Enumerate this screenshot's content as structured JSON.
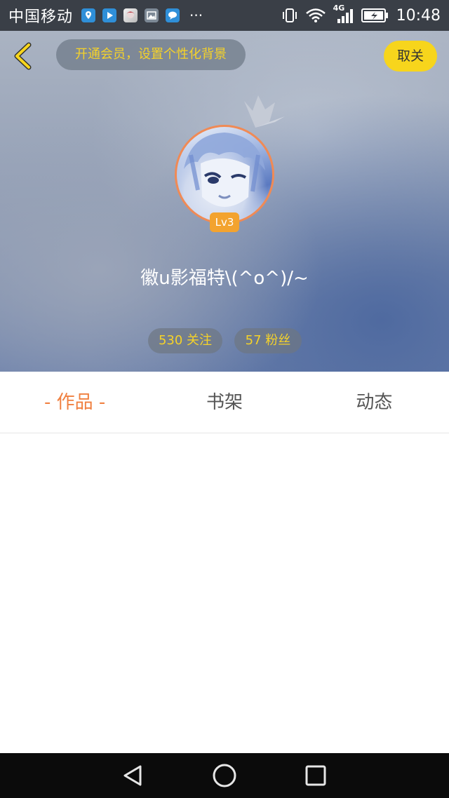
{
  "status_bar": {
    "carrier": "中国移动",
    "network": "4G",
    "time": "10:48",
    "notification_icons": [
      "location-icon",
      "video-play-icon",
      "anime-avatar-icon",
      "gallery-icon",
      "chat-bubble-icon"
    ],
    "more": "···"
  },
  "header": {
    "vip_prompt": "开通会员，设置个性化背景",
    "follow_button": "取关",
    "level": "Lv3",
    "username": "徽u影福特\\(^o^)/~",
    "stats": {
      "following": "530 关注",
      "fans": "57 粉丝"
    },
    "colors": {
      "accent_yellow": "#f5d229",
      "button_yellow": "#f7d51c",
      "avatar_ring": "#f08a55",
      "level_orange": "#f3a32f"
    }
  },
  "tabs": {
    "items": [
      {
        "label": "- 作品 -",
        "active": true
      },
      {
        "label": "书架",
        "active": false
      },
      {
        "label": "动态",
        "active": false
      }
    ],
    "active_color": "#f08040"
  },
  "nav_bar": {
    "buttons": [
      "back-triangle-icon",
      "home-circle-icon",
      "recents-square-icon"
    ]
  }
}
